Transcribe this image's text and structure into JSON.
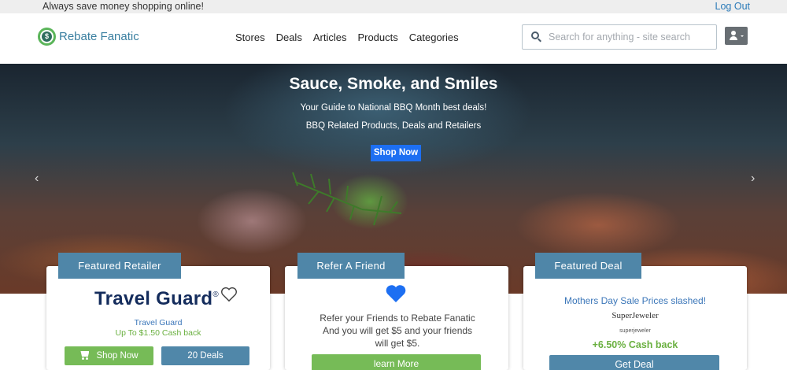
{
  "topbar": {
    "tagline": "Always save money shopping online!",
    "logout": "Log Out"
  },
  "header": {
    "logo_text": "Rebate Fanatic",
    "nav": [
      "Stores",
      "Deals",
      "Articles",
      "Products",
      "Categories"
    ],
    "search_placeholder": "Search for anything - site search"
  },
  "hero": {
    "title": "Sauce, Smoke, and Smiles",
    "subtitle1": "Your Guide to National BBQ Month best deals!",
    "subtitle2": "BBQ Related Products, Deals and Retailers",
    "cta": "Shop Now",
    "prev_glyph": "‹",
    "next_glyph": "›"
  },
  "featured_retailer": {
    "tab": "Featured Retailer",
    "logo_text": "Travel Guard",
    "logo_mark": "®",
    "name": "Travel Guard",
    "cashback": "Up To $1.50 Cash back",
    "shop_button": "Shop Now",
    "deals_button": "20 Deals"
  },
  "refer_friend": {
    "tab": "Refer A Friend",
    "text": "Refer your Friends to Rebate Fanatic And you will get $5 and your friends will get $5.",
    "button": "learn More"
  },
  "featured_deal": {
    "tab": "Featured Deal",
    "title": "Mothers Day Sale Prices slashed!",
    "logo_text": "SuperJeweler",
    "store_name": "superjeweler",
    "cashback": "+6.50% Cash back",
    "button": "Get Deal"
  },
  "colors": {
    "accent_blue": "#4f86a8",
    "cta_blue": "#1d6ff2",
    "green": "#76bb57",
    "link_blue": "#3c77b9"
  }
}
